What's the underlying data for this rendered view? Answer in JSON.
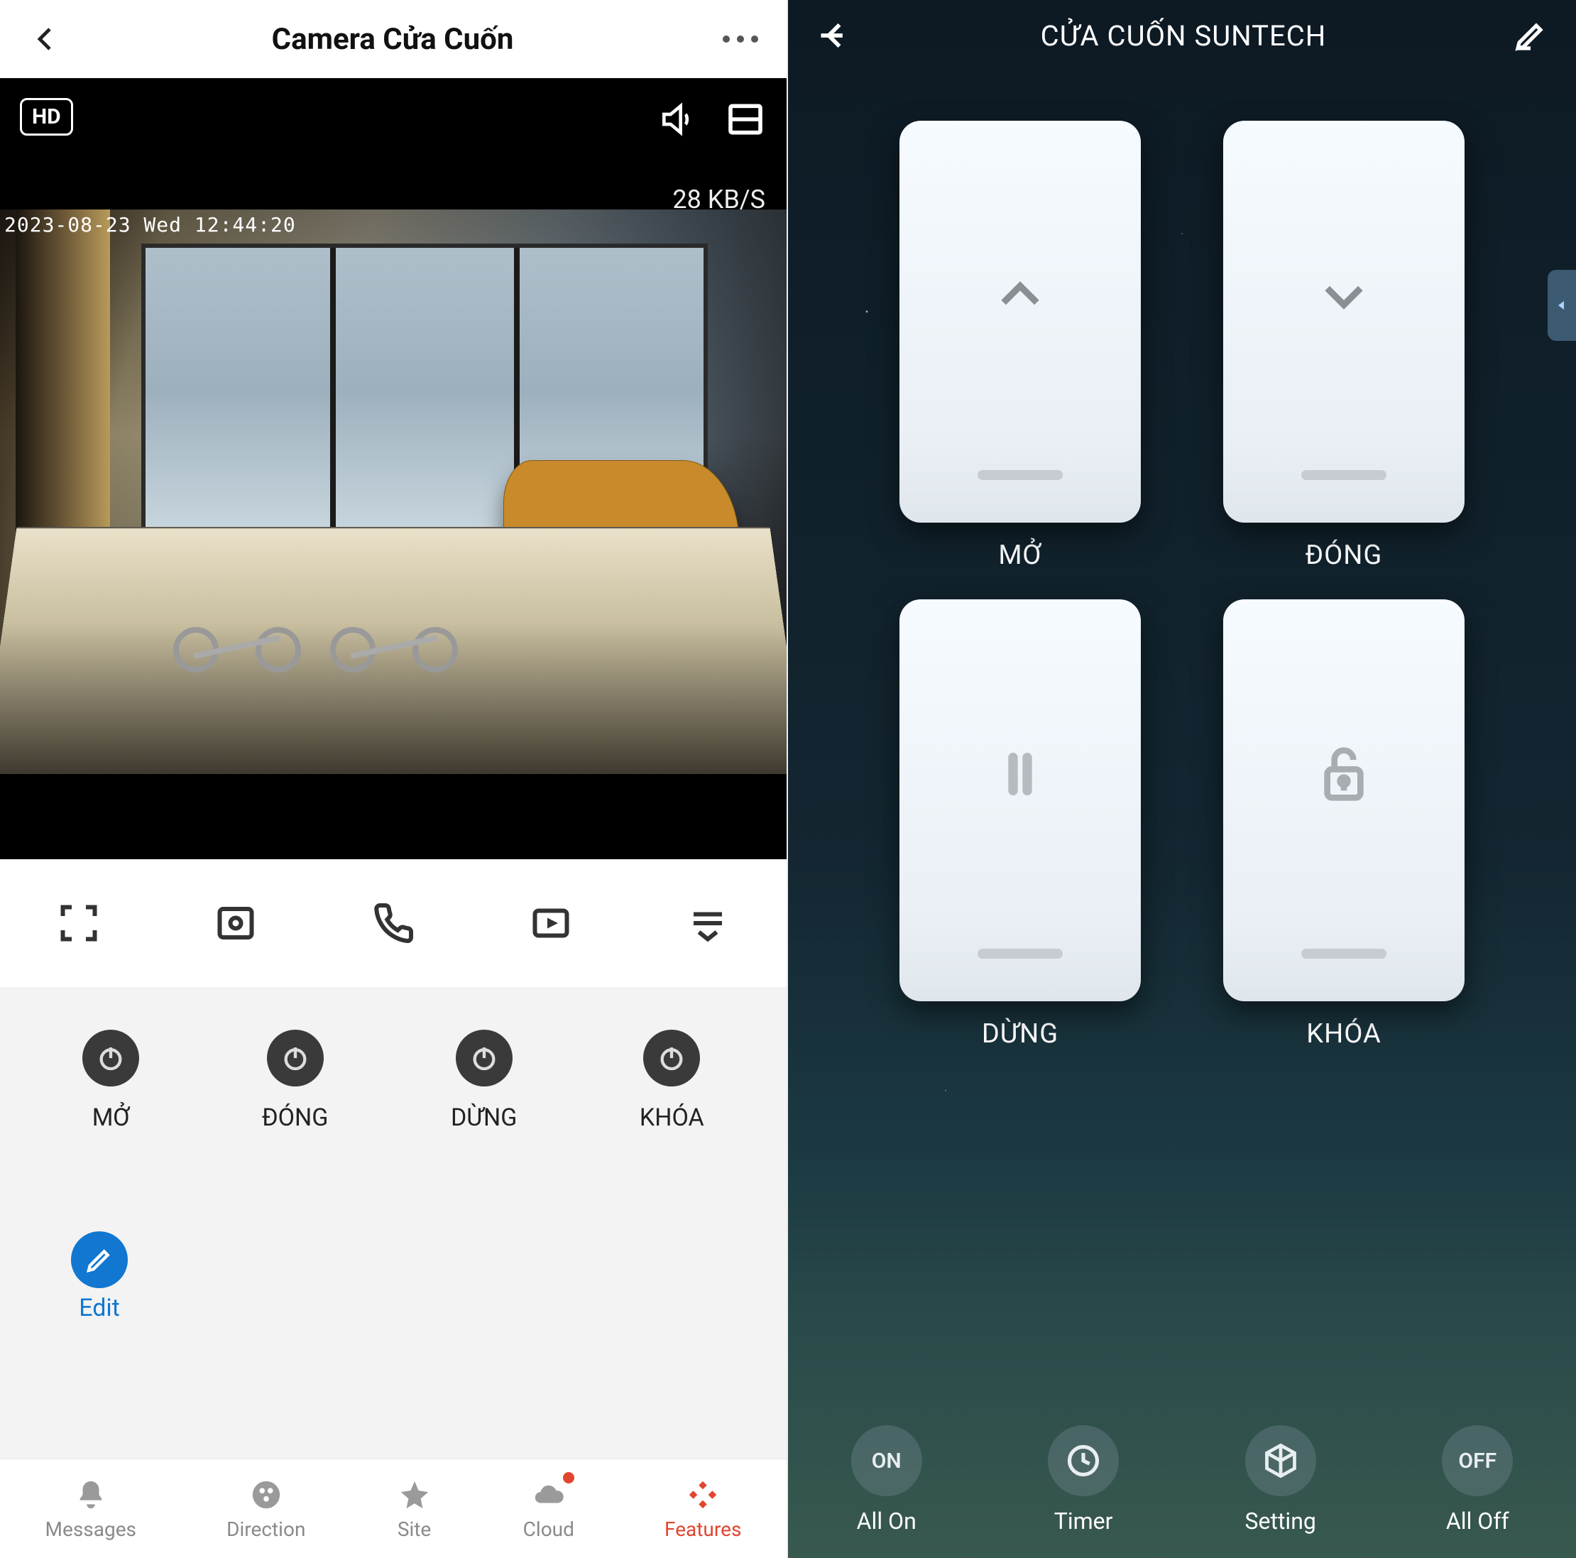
{
  "left": {
    "title": "Camera Cửa Cuốn",
    "hd_badge": "HD",
    "bitrate": "28 KB/S",
    "osd_timestamp": "2023-08-23 Wed 12:44:20",
    "toolbar_icons": [
      "fullscreen",
      "snapshot",
      "call",
      "record",
      "menu"
    ],
    "features": [
      {
        "label": "MỞ"
      },
      {
        "label": "ĐÓNG"
      },
      {
        "label": "DỪNG"
      },
      {
        "label": "KHÓA"
      }
    ],
    "edit_label": "Edit",
    "tabs": [
      {
        "label": "Messages",
        "icon": "bell",
        "active": false
      },
      {
        "label": "Direction",
        "icon": "directions",
        "active": false
      },
      {
        "label": "Site",
        "icon": "star",
        "active": false
      },
      {
        "label": "Cloud",
        "icon": "cloud",
        "active": false,
        "badge": true
      },
      {
        "label": "Features",
        "icon": "apps",
        "active": true
      }
    ]
  },
  "right": {
    "title": "CỬA CUỐN SUNTECH",
    "cards": [
      {
        "label": "MỞ",
        "icon": "chevron-up"
      },
      {
        "label": "ĐÓNG",
        "icon": "chevron-down"
      },
      {
        "label": "DỪNG",
        "icon": "pause"
      },
      {
        "label": "KHÓA",
        "icon": "unlock"
      }
    ],
    "bottom": [
      {
        "label": "All On",
        "text": "ON"
      },
      {
        "label": "Timer",
        "icon": "clock"
      },
      {
        "label": "Setting",
        "icon": "cube"
      },
      {
        "label": "All Off",
        "text": "OFF"
      }
    ]
  }
}
